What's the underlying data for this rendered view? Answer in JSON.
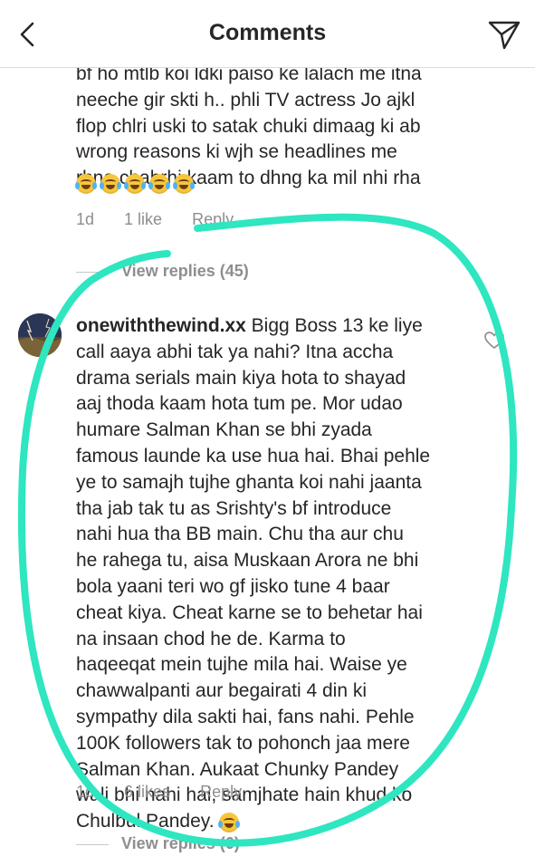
{
  "header": {
    "title": "Comments",
    "back_icon": "chevron-left-icon",
    "send_icon": "paper-plane-icon"
  },
  "comment1": {
    "lines": [
      "bf ho mtlb koi ldki paiso ke lalach me itna",
      "neeche gir skti h.. phli TV actress  Jo ajkl",
      "flop chlri uski to satak chuki dimaag ki ab",
      "wrong reasons ki wjh se headlines me",
      "rhna chahrhi kaam to dhng ka mil nhi rha"
    ],
    "emoji_count": 5,
    "emoji_name": "face-with-tears-of-joy",
    "time": "1d",
    "likes": "1 like",
    "reply": "Reply",
    "view_replies": "View replies (45)"
  },
  "comment2": {
    "username": "onewiththewind.xx",
    "lines": [
      " Bigg Boss 13 ke liye",
      "call aaya abhi tak ya nahi? Itna accha",
      "drama serials main kiya hota to shayad",
      "aaj thoda kaam hota tum pe. Mor udao",
      "humare Salman Khan se bhi zyada",
      "famous launde ka use hua hai. Bhai pehle",
      "ye to samajh tujhe ghanta koi nahi jaanta",
      "tha jab tak tu as Srishty's bf introduce",
      "nahi hua tha BB main. Chu tha aur chu",
      "he rahega tu, aisa Muskaan Arora ne bhi",
      "bola yaani teri wo gf jisko tune 4 baar",
      "cheat kiya. Cheat karne se to behetar hai",
      "na insaan chod he de. Karma to",
      "haqeeqat mein tujhe mila hai. Waise ye",
      "chawwalpanti aur begairati 4 din ki",
      "sympathy dila sakti hai, fans nahi. Pehle",
      "100K followers tak to pohonch jaa mere",
      "Salman Khan. Aukaat Chunky Pandey",
      "wali bhi nahi hai, samjhate hain khud ko",
      "Chulbul Pandey. "
    ],
    "time": "1d",
    "likes": "6 likes",
    "reply": "Reply",
    "view_replies": "View replies (6)",
    "heart_icon": "heart-outline-icon"
  },
  "colors": {
    "text": "#262626",
    "muted": "#8e8e8e",
    "annotation": "#2ee6c0"
  }
}
